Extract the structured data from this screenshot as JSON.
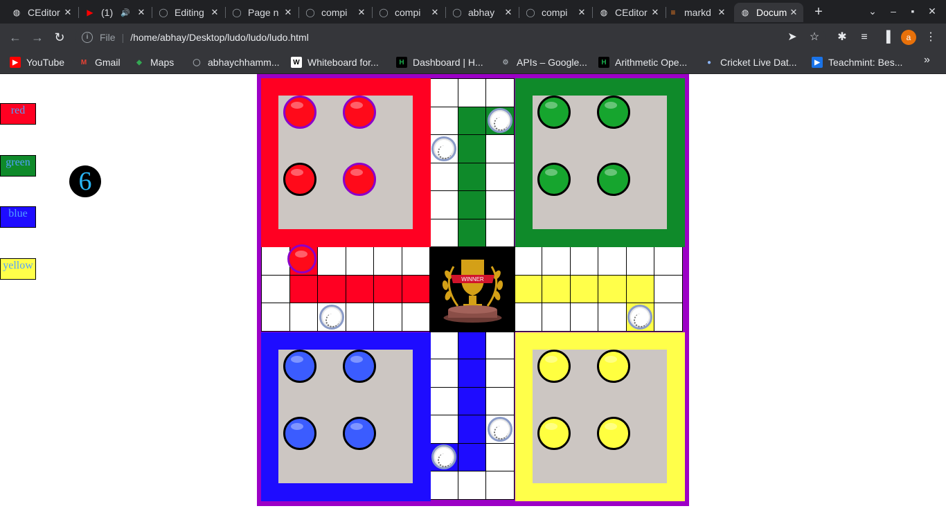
{
  "browser": {
    "tabs": [
      {
        "title": "CEditor",
        "icon": "globe"
      },
      {
        "title": "(1)",
        "icon": "youtube"
      },
      {
        "title": "Editing",
        "icon": "github"
      },
      {
        "title": "Page n",
        "icon": "github"
      },
      {
        "title": "compi",
        "icon": "github"
      },
      {
        "title": "compi",
        "icon": "github"
      },
      {
        "title": "abhay",
        "icon": "github"
      },
      {
        "title": "compi",
        "icon": "github"
      },
      {
        "title": "CEditor",
        "icon": "globe"
      },
      {
        "title": "markd",
        "icon": "stackoverflow"
      },
      {
        "title": "Docum",
        "icon": "globe",
        "active": true
      }
    ],
    "address": {
      "scheme_label": "File",
      "url": "/home/abhay/Desktop/ludo/ludo/ludo.html"
    },
    "profile_initial": "a",
    "bookmarks": [
      {
        "label": "YouTube",
        "icon": "youtube"
      },
      {
        "label": "Gmail",
        "icon": "gmail"
      },
      {
        "label": "Maps",
        "icon": "maps"
      },
      {
        "label": "abhaychhamm...",
        "icon": "github"
      },
      {
        "label": "Whiteboard for...",
        "icon": "whiteboard"
      },
      {
        "label": "Dashboard | H...",
        "icon": "hackerrank"
      },
      {
        "label": "APIs – Google...",
        "icon": "gear"
      },
      {
        "label": "Arithmetic Ope...",
        "icon": "hackerrank"
      },
      {
        "label": "Cricket Live Dat...",
        "icon": "cricket"
      },
      {
        "label": "Teachmint: Bes...",
        "icon": "teachmint"
      }
    ]
  },
  "game": {
    "player_buttons": [
      {
        "label": "red",
        "bg": "#ff0022",
        "fg": "#52a0ff"
      },
      {
        "label": "green",
        "bg": "#0f8a2a",
        "fg": "#52a0ff"
      },
      {
        "label": "blue",
        "bg": "#1e0cff",
        "fg": "#52a0ff"
      },
      {
        "label": "yellow",
        "bg": "#ffff4a",
        "fg": "#52a0ff"
      }
    ],
    "dice_value": "6",
    "winner_text": "WINNER",
    "colors": {
      "red": "#ff0022",
      "green": "#0f8a2a",
      "blue": "#1e0cff",
      "yellow": "#ffff4a",
      "border": "#9c00c6",
      "home_inner": "#ccc6c2",
      "piece_red": "#ff0a1a",
      "piece_green": "#16a52e",
      "piece_blue": "#3b5cff",
      "piece_yellow": "#ffff40"
    }
  }
}
